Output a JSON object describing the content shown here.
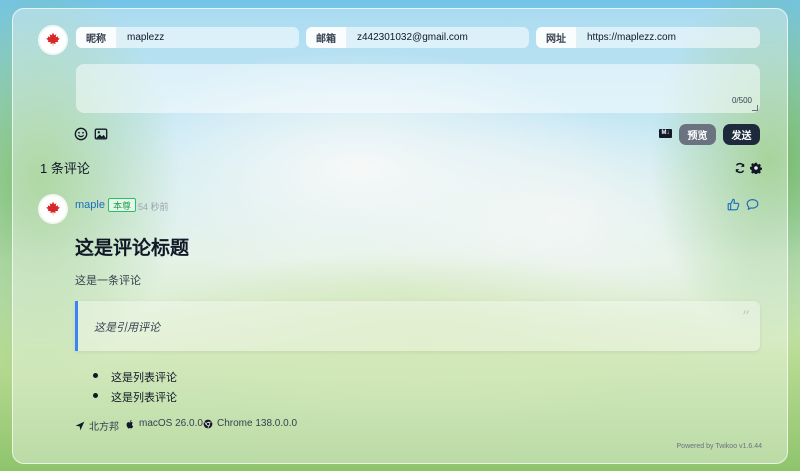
{
  "form": {
    "nick_label": "昵称",
    "nick_value": "maplezz",
    "mail_label": "邮箱",
    "mail_value": "z442301032@gmail.com",
    "site_label": "网址",
    "site_value": "https://maplezz.com",
    "char_counter": "0/500",
    "preview_label": "预览",
    "send_label": "发送",
    "markdown_icon_text": "M↓"
  },
  "comments": {
    "count_title": "1 条评论",
    "item": {
      "author": "maple",
      "badge": "本尊",
      "time": "54 秒前",
      "title": "这是评论标题",
      "text": "这是一条评论",
      "quote": "这是引用评论",
      "list": [
        "这是列表评论",
        "这是列表评论"
      ],
      "location": "北方邦",
      "os": "macOS 26.0.0",
      "browser": "Chrome 138.0.0.0"
    }
  },
  "footer": {
    "powered": "Powered by Twikoo v1.6.44"
  },
  "colors": {
    "accent": "#3b82f6",
    "send_button": "#1e293b",
    "preview_button": "#6b7280",
    "badge": "#22c55e"
  },
  "icons": [
    "maple-leaf-icon",
    "emoji-icon",
    "image-icon",
    "markdown-icon",
    "refresh-icon",
    "gear-icon",
    "thumbs-up-icon",
    "reply-icon",
    "location-arrow-icon",
    "apple-icon",
    "chrome-icon"
  ]
}
